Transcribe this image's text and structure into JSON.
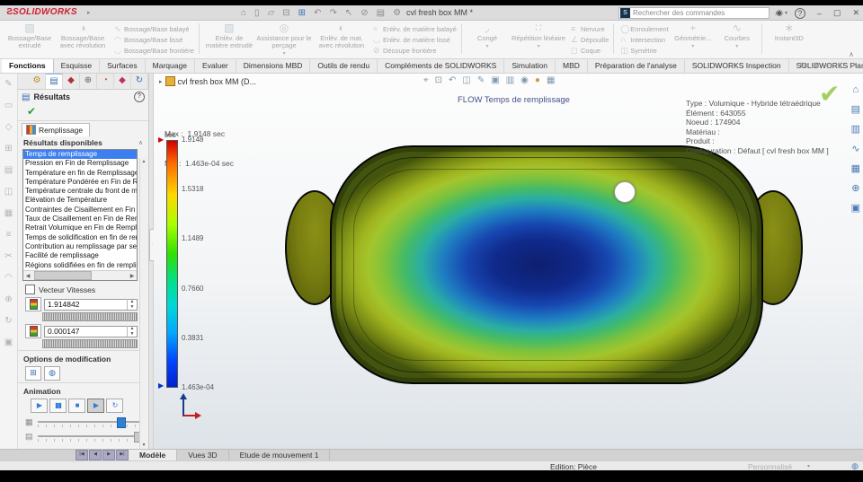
{
  "colors": {
    "sw_red": "#cf2030",
    "selection_blue": "#3d7ff0",
    "accent_blue": "#2f7fd3",
    "check_green": "#2e9e3e",
    "watermark_green": "#8dc63f"
  },
  "titlebar": {
    "logo_text": "SOLIDWORKS",
    "title": "cvl fresh box MM *",
    "search_placeholder": "Rechercher des commandes",
    "qat_icons": [
      {
        "name": "home-icon",
        "glyph": "⌂"
      },
      {
        "name": "new-document-icon",
        "glyph": "▯"
      },
      {
        "name": "open-document-icon",
        "glyph": "▱"
      },
      {
        "name": "save-icon",
        "glyph": "⊟"
      },
      {
        "name": "print-icon",
        "glyph": "⊞",
        "color": "#3b6fb5"
      },
      {
        "name": "undo-icon",
        "glyph": "↶"
      },
      {
        "name": "redo-icon",
        "glyph": "↷"
      },
      {
        "name": "select-icon",
        "glyph": "↖"
      },
      {
        "name": "delete-icon",
        "glyph": "⊘"
      },
      {
        "name": "report-icon",
        "glyph": "▤"
      },
      {
        "name": "options-icon",
        "glyph": "⚙"
      }
    ],
    "window_icons": [
      {
        "name": "sign-in-icon",
        "glyph": "◉"
      },
      {
        "name": "minimize-icon",
        "glyph": "–"
      },
      {
        "name": "restore-icon",
        "glyph": "▢"
      },
      {
        "name": "close-icon",
        "glyph": "✕"
      }
    ],
    "help_glyph": "?"
  },
  "ribbon": {
    "g1_b1": "Bossage/Base extrudé",
    "g1_b2": "Bossage/Base avec révolution",
    "g1_s1": "Bossage/Base balayé",
    "g1_s2": "Bossage/Base lissé",
    "g1_s3": "Bossage/Base frontière",
    "g2_b1": "Enlèv. de matière extrudé",
    "g2_b2": "Assistance pour le perçage",
    "g2_b3": "Enlèv. de mat. avec révolution",
    "g2_s1": "Enlèv. de matière balayé",
    "g2_s2": "Enlèv. de matière lissé",
    "g2_s3": "Découpe frontière",
    "g3_b1": "Congé",
    "g3_b2": "Répétition linéaire",
    "g3_s1": "Nervure",
    "g3_s2": "Dépouille",
    "g3_s3": "Coque",
    "g4_s1": "Enroulement",
    "g4_s2": "Intersection",
    "g4_s3": "Symétrie",
    "g4_b1": "Géométrie...",
    "g4_b2": "Courbes",
    "g4_b3": "Instant3D",
    "caret": "▾",
    "collapse": "∧",
    "icons": {
      "extrude": "▧",
      "revolve": "◑",
      "sweep": "∿",
      "loft": "◠",
      "boundary": "◡",
      "cut_extrude": "▨",
      "hole_wizard": "◎",
      "cut_revolve": "◐",
      "cut_sweep": "≈",
      "cut_loft": "◡",
      "cut_boundary": "⊘",
      "fillet": "◞",
      "pattern": "∷",
      "rib": "≡",
      "draft": "∠",
      "shell": "◻",
      "wrap": "◯",
      "intersect": "∩",
      "mirror": "◫",
      "ref_geometry": "+",
      "curves": "∿",
      "instant3d": "∗"
    }
  },
  "command_tabs": {
    "items": [
      {
        "label": "Fonctions",
        "active": true
      },
      {
        "label": "Esquisse"
      },
      {
        "label": "Surfaces"
      },
      {
        "label": "Marquage"
      },
      {
        "label": "Evaluer"
      },
      {
        "label": "Dimensions MBD"
      },
      {
        "label": "Outils de rendu"
      },
      {
        "label": "Compléments de SOLIDWORKS"
      },
      {
        "label": "Simulation"
      },
      {
        "label": "MBD"
      },
      {
        "label": "Préparation de l'analyse"
      },
      {
        "label": "SOLIDWORKS Inspection"
      },
      {
        "label": "SOLIDWORKS Plastics"
      }
    ]
  },
  "doc_window_icons": [
    {
      "name": "viewport-split-icon",
      "glyph": "⊟"
    },
    {
      "name": "viewport-quad-icon",
      "glyph": "⊞"
    },
    {
      "name": "doc-minimize-icon",
      "glyph": "–"
    },
    {
      "name": "doc-restore-icon",
      "glyph": "▢"
    },
    {
      "name": "doc-close-icon",
      "glyph": "✕"
    }
  ],
  "left_strip_icons": [
    {
      "name": "sketch-tool-icon",
      "glyph": "✎"
    },
    {
      "name": "plane-tool-icon",
      "glyph": "▭"
    },
    {
      "name": "domain-tool-icon",
      "glyph": "◇"
    },
    {
      "name": "mesh-tool-icon",
      "glyph": "⊞"
    },
    {
      "name": "layers-tool-icon",
      "glyph": "▤"
    },
    {
      "name": "mirror-tool-icon",
      "glyph": "◫"
    },
    {
      "name": "grid-tool-icon",
      "glyph": "▦"
    },
    {
      "name": "list-tool-icon",
      "glyph": "≡"
    },
    {
      "name": "trim-tool-icon",
      "glyph": "✂"
    },
    {
      "name": "arc-tool-icon",
      "glyph": "◠"
    },
    {
      "name": "probe-tool-icon",
      "glyph": "⊕"
    },
    {
      "name": "rebuild-tool-icon",
      "glyph": "↻"
    },
    {
      "name": "display-tool-icon",
      "glyph": "▣"
    }
  ],
  "panel": {
    "tabs": [
      {
        "name": "plastics-manager-tab-icon",
        "glyph": "⚙",
        "color": "#c09020"
      },
      {
        "name": "results-tab-icon",
        "glyph": "▤",
        "color": "#3a6fb0",
        "active": true
      },
      {
        "name": "boundary-tab-icon",
        "glyph": "◆",
        "color": "#b03030"
      },
      {
        "name": "mesh-tab-icon",
        "glyph": "⊕",
        "color": "#606060"
      },
      {
        "name": "material-tab-icon",
        "glyph": "◔",
        "color": "#c06020"
      },
      {
        "name": "injection-tab-icon",
        "glyph": "◆",
        "color": "#c03060"
      },
      {
        "name": "refresh-tab-icon",
        "glyph": "↻",
        "color": "#3a6fb0"
      }
    ],
    "title": "Résultats",
    "help_glyph": "?",
    "check_glyph": "✔",
    "study_tab": "Remplissage",
    "results_header": "Résultats disponibles",
    "results": [
      "Temps de remplissage",
      "Pression en Fin de Remplissage",
      "Température en fin de Remplissage",
      "Température Pondérée en Fin de Rempli",
      "Température centrale du front de matièr",
      "Elévation de Température",
      "Contraintes de Cisaillement en Fin de Re",
      "Taux de Cisaillement en Fin de Remplissa",
      "Retrait Volumique en Fin de Remplissage",
      "Temps de solidification en fin de remplis",
      "Contribution au remplissage par seuil",
      "Facilité de remplissage",
      "Régions solidifiées en fin de remplissage"
    ],
    "vector_checkbox": "Vecteur Vitesses",
    "max_value": "1.914842",
    "min_value": "0.000147",
    "options_header": "Options de modification",
    "animation_header": "Animation",
    "transport": [
      {
        "name": "play-button",
        "glyph": "▶"
      },
      {
        "name": "pause-button",
        "glyph": "▮▮"
      },
      {
        "name": "stop-button",
        "glyph": "■"
      },
      {
        "name": "play-from-start-button",
        "glyph": "▶"
      },
      {
        "name": "loop-button",
        "glyph": "↻"
      }
    ]
  },
  "viewport": {
    "tree_item": "cvl fresh box MM (D...",
    "headsup_icons": [
      {
        "name": "zoom-fit-icon",
        "glyph": "⌖"
      },
      {
        "name": "zoom-area-icon",
        "glyph": "⊡"
      },
      {
        "name": "previous-view-icon",
        "glyph": "↶"
      },
      {
        "name": "section-view-icon",
        "glyph": "◫"
      },
      {
        "name": "annotation-icon",
        "glyph": "✎"
      },
      {
        "name": "view-orientation-icon",
        "glyph": "▣"
      },
      {
        "name": "display-style-icon",
        "glyph": "▥"
      },
      {
        "name": "hide-show-icon",
        "glyph": "◉"
      },
      {
        "name": "appearance-icon",
        "glyph": "●",
        "color": "#c8a040"
      },
      {
        "name": "view-settings-icon",
        "glyph": "▦"
      }
    ],
    "plot_title": "FLOW Temps de remplissage",
    "max_label": "Max :  1.9148 sec",
    "min_label": "Min :  1.463e-04 sec",
    "legend": {
      "unit": "sec",
      "ticks": [
        "1.9148",
        "1.5318",
        "1.1489",
        "0.7660",
        "0.3831",
        "1.463e-04"
      ]
    },
    "info_lines": [
      "Type : Volumique - Hybride tétraédrique",
      "Élément : 643055",
      "Noeud : 174904",
      "Matériau :",
      "Produit :",
      "Configuration : Défaut [ cvl fresh box MM ]"
    ],
    "watermark_check": "✔",
    "right_tool_icons": [
      {
        "name": "home-view-icon",
        "glyph": "⌂"
      },
      {
        "name": "clipping-icon",
        "glyph": "▤"
      },
      {
        "name": "plot-tools-icon",
        "glyph": "▥"
      },
      {
        "name": "xy-plot-icon",
        "glyph": "∿"
      },
      {
        "name": "isosurface-icon",
        "glyph": "▦"
      },
      {
        "name": "probe-icon",
        "glyph": "⊕"
      },
      {
        "name": "report-view-icon",
        "glyph": "▣"
      }
    ]
  },
  "bottom": {
    "doc_tabs": [
      {
        "label": "Modèle",
        "active": true
      },
      {
        "label": "Vues 3D"
      },
      {
        "label": "Etude de mouvement 1"
      }
    ],
    "status_mode": "Edition: Pièce",
    "status_profile": "Personnalisé"
  }
}
